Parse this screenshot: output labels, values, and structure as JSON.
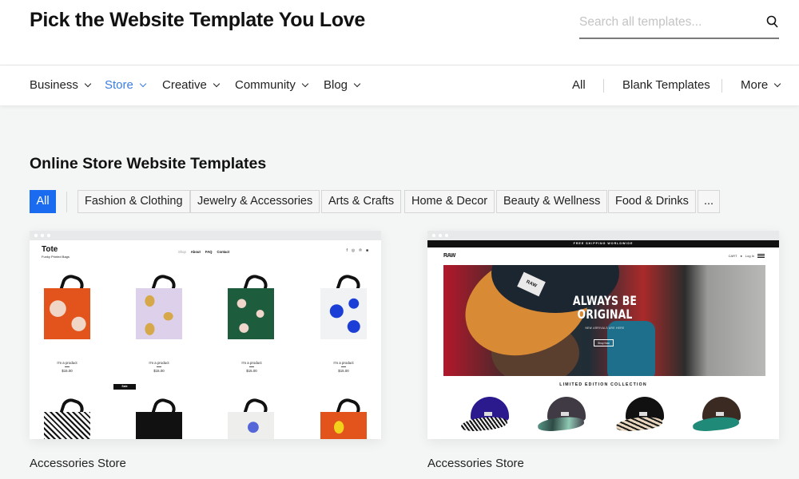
{
  "header": {
    "title": "Pick the Website Template You Love",
    "search_placeholder": "Search all templates..."
  },
  "nav": {
    "left": [
      {
        "label": "Business",
        "active": false
      },
      {
        "label": "Store",
        "active": true
      },
      {
        "label": "Creative",
        "active": false
      },
      {
        "label": "Community",
        "active": false
      },
      {
        "label": "Blog",
        "active": false
      }
    ],
    "right": {
      "all": "All",
      "blank": "Blank Templates",
      "more": "More"
    },
    "accent_color": "#3a7ee0"
  },
  "section": {
    "title": "Online Store Website Templates",
    "filters": [
      {
        "label": "All",
        "active": true
      },
      {
        "label": "Fashion & Clothing"
      },
      {
        "label": "Jewelry & Accessories"
      },
      {
        "label": "Arts & Crafts"
      },
      {
        "label": "Home & Decor"
      },
      {
        "label": "Beauty & Wellness"
      },
      {
        "label": "Food & Drinks"
      },
      {
        "label": "..."
      }
    ],
    "active_filter_color": "#1a6bef"
  },
  "templates": [
    {
      "name": "Accessories Store",
      "preview": {
        "brand": "Tote",
        "tagline": "Funky Printed Bags",
        "menu": [
          "Shop",
          "About",
          "FAQ",
          "Contact"
        ],
        "social_icons": [
          "facebook-icon",
          "instagram-icon",
          "pinterest-icon",
          "bag-icon"
        ],
        "products": [
          {
            "name": "I'm a product",
            "price": "$15.00"
          },
          {
            "name": "I'm a product",
            "price": "$15.00"
          },
          {
            "name": "I'm a product",
            "price": "$15.00"
          },
          {
            "name": "I'm a product",
            "price": "$15.00"
          }
        ],
        "sale_badge": "Sale"
      }
    },
    {
      "name": "Accessories Store",
      "preview": {
        "banner": "FREE SHIPPING WORLDWIDE",
        "brand": "RAW",
        "cart": "CART",
        "login": "Log In",
        "hero_title_line1": "ALWAYS BE",
        "hero_title_line2": "ORIGINAL",
        "hero_subtitle": "NEW ARRIVALS ARE HERE",
        "hero_button": "Shop Now",
        "collection_title": "LIMITED EDITION COLLECTION"
      }
    }
  ]
}
